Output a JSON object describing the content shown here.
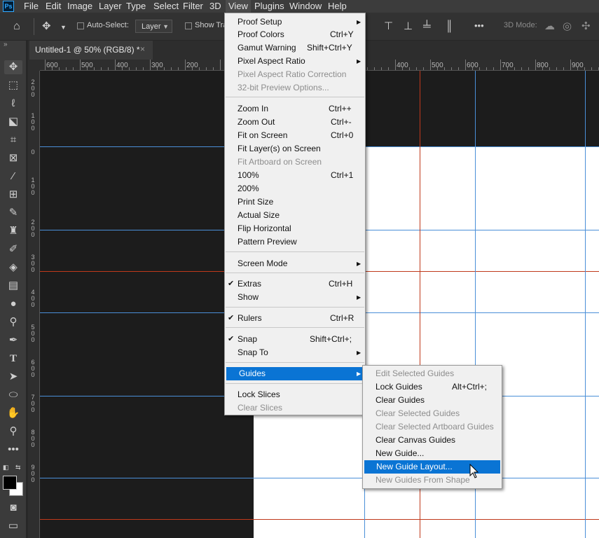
{
  "app": {
    "logo_text": "Ps"
  },
  "menubar": {
    "items": [
      "File",
      "Edit",
      "Image",
      "Layer",
      "Type",
      "Select",
      "Filter",
      "3D",
      "View",
      "Plugins",
      "Window",
      "Help"
    ],
    "active": "View"
  },
  "options_bar": {
    "auto_select_label": "Auto-Select:",
    "layer_select_value": "Layer",
    "show_transform_label": "Show Tra",
    "more_label": "•••",
    "mode_label": "3D Mode:"
  },
  "document_tab": {
    "title": "Untitled-1 @ 50% (RGB/8) *",
    "close": "×"
  },
  "ruler_top_labels": [
    "600",
    "500",
    "400",
    "300",
    "200",
    "",
    "",
    "",
    "",
    "",
    "400",
    "500",
    "600",
    "700",
    "800",
    "900"
  ],
  "ruler_left_labels": [
    "2 0 0",
    "1 0 0",
    "0",
    "1 0 0",
    "2 0 0",
    "3 0 0",
    "4 0 0",
    "5 0 0",
    "6 0 0",
    "7 0 0",
    "8 0 0",
    "9 0 0"
  ],
  "view_menu": {
    "items": [
      {
        "label": "Proof Setup",
        "submenu": true
      },
      {
        "label": "Proof Colors",
        "shortcut": "Ctrl+Y"
      },
      {
        "label": "Gamut Warning",
        "shortcut": "Shift+Ctrl+Y"
      },
      {
        "label": "Pixel Aspect Ratio",
        "submenu": true
      },
      {
        "label": "Pixel Aspect Ratio Correction",
        "disabled": true
      },
      {
        "label": "32-bit Preview Options...",
        "disabled": true
      },
      {
        "label": "Zoom In",
        "shortcut": "Ctrl++"
      },
      {
        "label": "Zoom Out",
        "shortcut": "Ctrl+-"
      },
      {
        "label": "Fit on Screen",
        "shortcut": "Ctrl+0"
      },
      {
        "label": "Fit Layer(s) on Screen"
      },
      {
        "label": "Fit Artboard on Screen",
        "disabled": true
      },
      {
        "label": "100%",
        "shortcut": "Ctrl+1"
      },
      {
        "label": "200%"
      },
      {
        "label": "Print Size"
      },
      {
        "label": "Actual Size"
      },
      {
        "label": "Flip Horizontal"
      },
      {
        "label": "Pattern Preview"
      },
      {
        "label": "Screen Mode",
        "submenu": true
      },
      {
        "label": "Extras",
        "shortcut": "Ctrl+H",
        "checked": true
      },
      {
        "label": "Show",
        "submenu": true
      },
      {
        "label": "Rulers",
        "shortcut": "Ctrl+R",
        "checked": true
      },
      {
        "label": "Snap",
        "shortcut": "Shift+Ctrl+;",
        "checked": true
      },
      {
        "label": "Snap To",
        "submenu": true
      },
      {
        "label": "Guides",
        "submenu": true,
        "highlighted": true
      },
      {
        "label": "Lock Slices"
      },
      {
        "label": "Clear Slices",
        "disabled": true
      }
    ]
  },
  "guides_submenu": {
    "items": [
      {
        "label": "Edit Selected Guides",
        "disabled": true
      },
      {
        "label": "Lock Guides",
        "shortcut": "Alt+Ctrl+;"
      },
      {
        "label": "Clear Guides"
      },
      {
        "label": "Clear Selected Guides",
        "disabled": true
      },
      {
        "label": "Clear Selected Artboard Guides",
        "disabled": true
      },
      {
        "label": "Clear Canvas Guides"
      },
      {
        "label": "New Guide..."
      },
      {
        "label": "New Guide Layout...",
        "highlighted": true
      },
      {
        "label": "New Guides From Shape",
        "disabled": true
      }
    ]
  },
  "colors": {
    "accent": "#0a74d4",
    "guide_blue": "#4a8fd8",
    "guide_red": "#c0391b"
  },
  "tools": [
    "move-icon",
    "marquee-icon",
    "lasso-icon",
    "object-select-icon",
    "crop-icon",
    "frame-icon",
    "eyedropper-icon",
    "healing-icon",
    "brush-icon",
    "stamp-icon",
    "history-brush-icon",
    "eraser-icon",
    "gradient-icon",
    "blur-icon",
    "dodge-icon",
    "pen-icon",
    "type-icon",
    "path-select-icon",
    "shape-icon",
    "hand-icon",
    "zoom-icon",
    "more-tools-icon"
  ]
}
